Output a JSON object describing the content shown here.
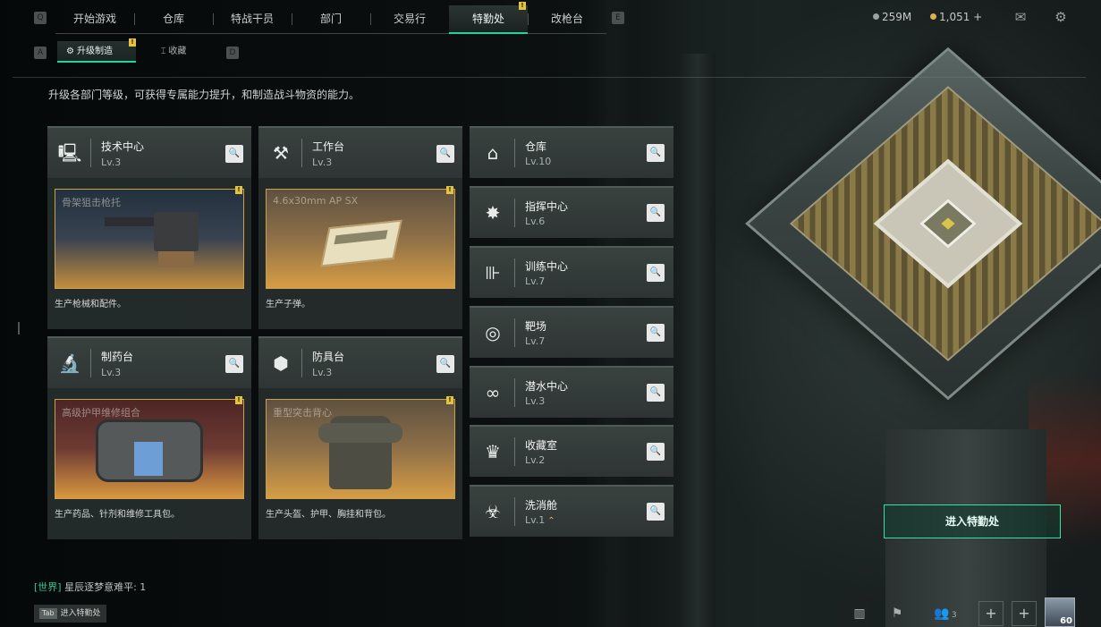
{
  "top_nav": {
    "left_key": "Q",
    "right_key": "E",
    "tabs": [
      {
        "label": "开始游戏"
      },
      {
        "label": "仓库"
      },
      {
        "label": "特战干员"
      },
      {
        "label": "部门"
      },
      {
        "label": "交易行"
      },
      {
        "label": "特勤处",
        "active": true,
        "badge": "!"
      },
      {
        "label": "改枪台"
      }
    ],
    "currency_1": "259M",
    "currency_2": "1,051 +"
  },
  "sub_nav": {
    "left_key": "A",
    "right_key": "D",
    "tabs": [
      {
        "label": "升级制造",
        "active": true,
        "badge": "!"
      },
      {
        "label": "收藏"
      }
    ]
  },
  "description": "升级各部门等级，可获得专属能力提升，和制造战斗物资的能力。",
  "big_cards": [
    {
      "name": "技术中心",
      "level": "Lv.3",
      "icon": "computer-icon",
      "product": "骨架狙击枪托",
      "footer": "生产枪械和配件。",
      "badge": "!"
    },
    {
      "name": "工作台",
      "level": "Lv.3",
      "icon": "tools-icon",
      "product": "4.6x30mm AP SX",
      "footer": "生产子弹。",
      "badge": "!"
    },
    {
      "name": "制药台",
      "level": "Lv.3",
      "icon": "microscope-icon",
      "product": "高级护甲维修组合",
      "footer": "生产药品、针剂和维修工具包。",
      "badge": "!"
    },
    {
      "name": "防具台",
      "level": "Lv.3",
      "icon": "cubes-icon",
      "product": "重型突击背心",
      "footer": "生产头盔、护甲、胸挂和背包。",
      "badge": "!"
    }
  ],
  "small_cards": [
    {
      "name": "仓库",
      "level": "Lv.10",
      "icon": "warehouse-icon"
    },
    {
      "name": "指挥中心",
      "level": "Lv.6",
      "icon": "command-icon"
    },
    {
      "name": "训练中心",
      "level": "Lv.7",
      "icon": "dumbbell-icon"
    },
    {
      "name": "靶场",
      "level": "Lv.7",
      "icon": "target-icon"
    },
    {
      "name": "潜水中心",
      "level": "Lv.3",
      "icon": "goggles-icon"
    },
    {
      "name": "收藏室",
      "level": "Lv.2",
      "icon": "trophy-icon"
    },
    {
      "name": "洗消舱",
      "level": "Lv.1",
      "icon": "hazmat-icon",
      "upgrade": "⌃"
    }
  ],
  "enter_button": "进入特勤处",
  "chat": {
    "channel": "[世界]",
    "message": "星辰逐梦意难平: 1"
  },
  "tab_hint": {
    "key": "Tab",
    "label": "进入特勤处"
  },
  "team_count": "3",
  "avatar_level": "60",
  "colors": {
    "accent": "#1fd69a",
    "badge": "#e4c43d",
    "frame": "#c9a14a"
  }
}
